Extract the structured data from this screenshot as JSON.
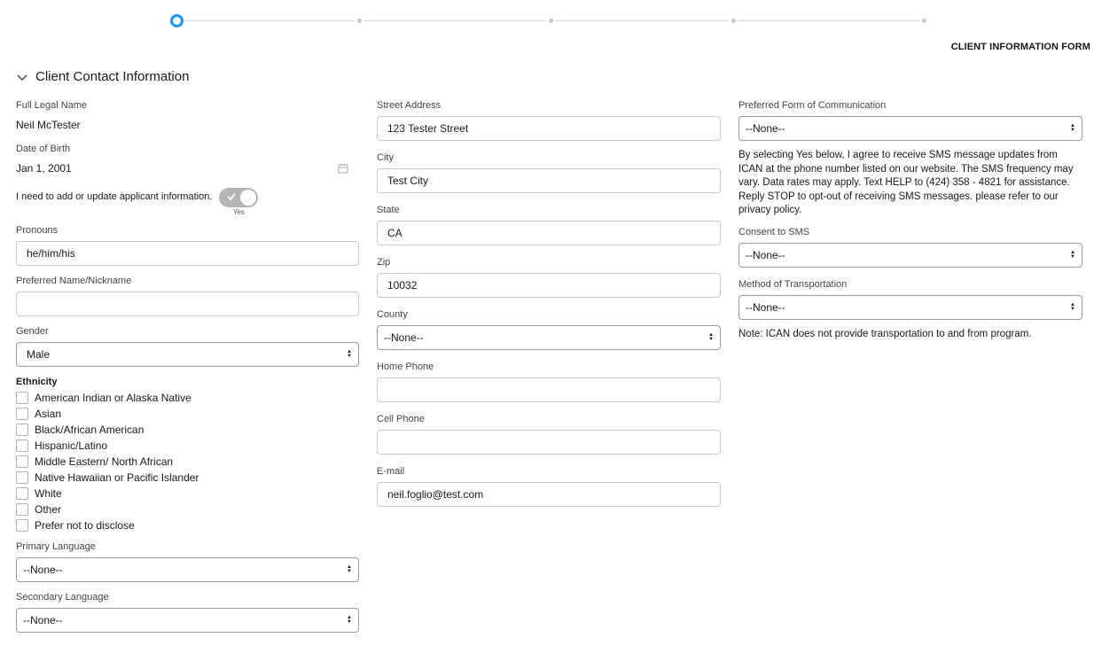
{
  "form_title": "CLIENT INFORMATION FORM",
  "section_title": "Client Contact Information",
  "left": {
    "full_name_label": "Full Legal Name",
    "full_name_value": "Neil McTester",
    "dob_label": "Date of Birth",
    "dob_value": "Jan 1, 2001",
    "toggle_label": "I need to add or update applicant information.",
    "toggle_caption": "Yes",
    "pronouns_label": "Pronouns",
    "pronouns_value": "he/him/his",
    "nickname_label": "Preferred Name/Nickname",
    "nickname_value": "",
    "gender_label": "Gender",
    "gender_value": "Male",
    "ethnicity_label": "Ethnicity",
    "ethnicity_options": [
      "American Indian or Alaska Native",
      "Asian",
      "Black/African American",
      "Hispanic/Latino",
      "Middle Eastern/ North African",
      "Native Hawaiian or Pacific Islander",
      "White",
      "Other",
      "Prefer not to disclose"
    ],
    "primary_language_label": "Primary Language",
    "primary_language_value": "--None--",
    "secondary_language_label": "Secondary Language",
    "secondary_language_value": "--None--"
  },
  "middle": {
    "street_label": "Street Address",
    "street_value": "123 Tester Street",
    "city_label": "City",
    "city_value": "Test City",
    "state_label": "State",
    "state_value": "CA",
    "zip_label": "Zip",
    "zip_value": "10032",
    "county_label": "County",
    "county_value": "--None--",
    "home_phone_label": "Home Phone",
    "home_phone_value": "",
    "cell_phone_label": "Cell Phone",
    "cell_phone_value": "",
    "email_label": "E-mail",
    "email_value": "neil.foglio@test.com"
  },
  "right": {
    "communication_label": "Preferred Form of Communication",
    "communication_value": "--None--",
    "sms_disclaimer": "By selecting Yes below, I agree to receive SMS message updates from ICAN at the phone number listed on our website. The SMS frequency may vary. Data rates may apply. Text HELP to (424) 358 - 4821 for assistance. Reply STOP to opt-out of receiving SMS messages. please refer to our privacy policy.",
    "consent_label": "Consent to SMS",
    "consent_value": "--None--",
    "transport_label": "Method of Transportation",
    "transport_value": "--None--",
    "transport_note": "Note: ICAN does not provide transportation to and from program."
  },
  "colors": {
    "accent": "#1b96ff",
    "toggle_on": "#b5b5b5",
    "border": "#c9c9c9"
  }
}
